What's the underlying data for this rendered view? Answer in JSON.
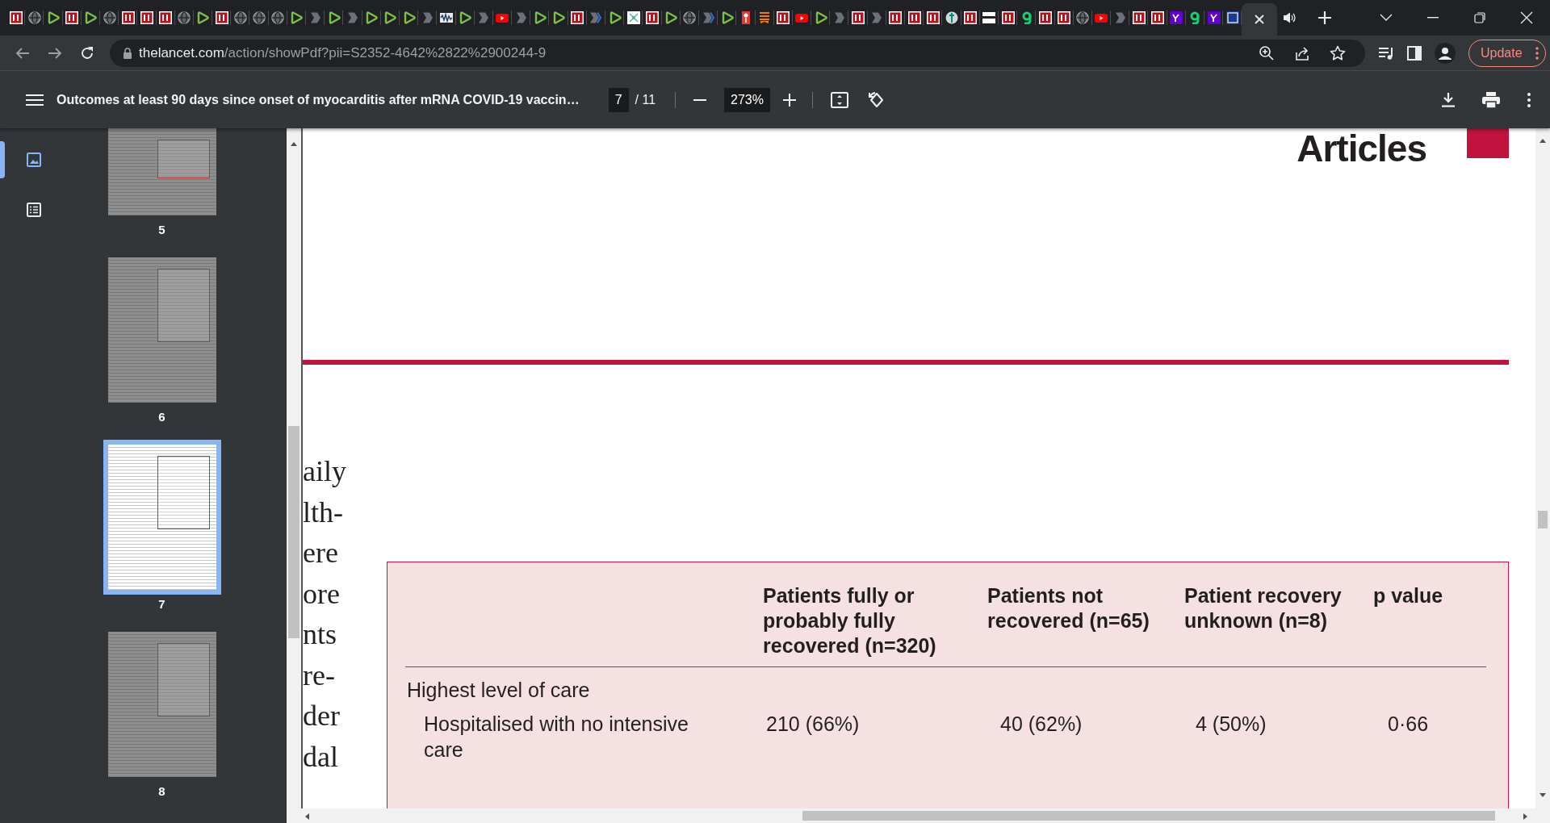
{
  "browser": {
    "tabs": [
      {
        "kind": "bi",
        "selected": false
      },
      {
        "kind": "globe",
        "selected": false
      },
      {
        "kind": "play",
        "selected": false
      },
      {
        "kind": "bi",
        "selected": false
      },
      {
        "kind": "play",
        "selected": false
      },
      {
        "kind": "globe",
        "selected": false
      },
      {
        "kind": "bi",
        "selected": false
      },
      {
        "kind": "bi",
        "selected": false
      },
      {
        "kind": "bi",
        "selected": false
      },
      {
        "kind": "globe",
        "selected": false
      },
      {
        "kind": "play",
        "selected": false
      },
      {
        "kind": "bi",
        "selected": false
      },
      {
        "kind": "globe",
        "selected": false
      },
      {
        "kind": "globe",
        "selected": false
      },
      {
        "kind": "globe",
        "selected": false
      },
      {
        "kind": "play",
        "selected": false
      },
      {
        "kind": "chevron",
        "selected": false
      },
      {
        "kind": "play",
        "selected": false
      },
      {
        "kind": "chevron",
        "selected": false
      },
      {
        "kind": "play",
        "selected": false
      },
      {
        "kind": "play",
        "selected": false
      },
      {
        "kind": "play",
        "selected": false
      },
      {
        "kind": "chevron",
        "selected": false
      },
      {
        "kind": "wave",
        "selected": false
      },
      {
        "kind": "play",
        "selected": false
      },
      {
        "kind": "chevron",
        "selected": false
      },
      {
        "kind": "youtube",
        "selected": false
      },
      {
        "kind": "chevron",
        "selected": false
      },
      {
        "kind": "play",
        "selected": false
      },
      {
        "kind": "play",
        "selected": false
      },
      {
        "kind": "bi",
        "selected": false
      },
      {
        "kind": "bluechevron",
        "selected": false
      },
      {
        "kind": "play",
        "selected": false
      },
      {
        "kind": "image",
        "selected": false
      },
      {
        "kind": "bi",
        "selected": false
      },
      {
        "kind": "play",
        "selected": false
      },
      {
        "kind": "globe",
        "selected": false
      },
      {
        "kind": "bluechevron",
        "selected": false
      },
      {
        "kind": "play",
        "selected": false
      },
      {
        "kind": "pin",
        "selected": false
      },
      {
        "kind": "bookmark",
        "selected": false
      },
      {
        "kind": "bi",
        "selected": false
      },
      {
        "kind": "youtube",
        "selected": false
      },
      {
        "kind": "play",
        "selected": false
      },
      {
        "kind": "chevron",
        "selected": false
      },
      {
        "kind": "bi",
        "selected": false
      },
      {
        "kind": "chevron",
        "selected": false
      },
      {
        "kind": "bi",
        "selected": false
      },
      {
        "kind": "bi",
        "selected": false
      },
      {
        "kind": "bi",
        "selected": false
      },
      {
        "kind": "emblem",
        "selected": false
      },
      {
        "kind": "bi",
        "selected": false
      },
      {
        "kind": "banner",
        "selected": false
      },
      {
        "kind": "bi",
        "selected": false
      },
      {
        "kind": "hook",
        "selected": false
      },
      {
        "kind": "bi",
        "selected": false
      },
      {
        "kind": "bi",
        "selected": false
      },
      {
        "kind": "globe",
        "selected": false
      },
      {
        "kind": "youtube",
        "selected": false
      },
      {
        "kind": "chevron",
        "selected": false
      },
      {
        "kind": "bi",
        "selected": false
      },
      {
        "kind": "bi",
        "selected": false
      },
      {
        "kind": "yahoo",
        "selected": false
      },
      {
        "kind": "hook",
        "selected": false
      },
      {
        "kind": "yahoo",
        "selected": false
      },
      {
        "kind": "square",
        "selected": false
      },
      {
        "kind": "blank",
        "selected": true
      }
    ],
    "address_bar": {
      "host": "thelancet.com",
      "path": "/action/showPdf?pii=S2352-4642%2822%2900244-9"
    },
    "update_button": "Update"
  },
  "pdf_toolbar": {
    "title": "Outcomes at least 90 days since onset of myocarditis after mRNA COVID-19 vaccin…",
    "page": "7",
    "page_count": "/ 11",
    "zoom": "273%"
  },
  "sidebar": {
    "views": [
      {
        "kind": "thumbnails",
        "selected": true
      },
      {
        "kind": "outline",
        "selected": false
      }
    ],
    "thumbnails": [
      {
        "label": "5",
        "selected": false
      },
      {
        "label": "6",
        "selected": false
      },
      {
        "label": "7",
        "selected": true
      },
      {
        "label": "8",
        "selected": false
      }
    ]
  },
  "document": {
    "header": "Articles",
    "body_fragments": [
      "aily",
      "lth-",
      "ere",
      "ore",
      "nts",
      "re-",
      "der",
      "dal"
    ],
    "table": {
      "columns": [
        "",
        "Patients fully or probably fully recovered (n=320)",
        "Patients not recovered (n=65)",
        "Patient recovery unknown (n=8)",
        "p value"
      ],
      "rows": [
        {
          "kind": "group",
          "cells": [
            "Highest level of care"
          ]
        },
        {
          "kind": "item",
          "cells": [
            "Hospitalised with no intensive care",
            "210 (66%)",
            "40 (62%)",
            "4 (50%)",
            "0·66"
          ]
        }
      ]
    }
  }
}
